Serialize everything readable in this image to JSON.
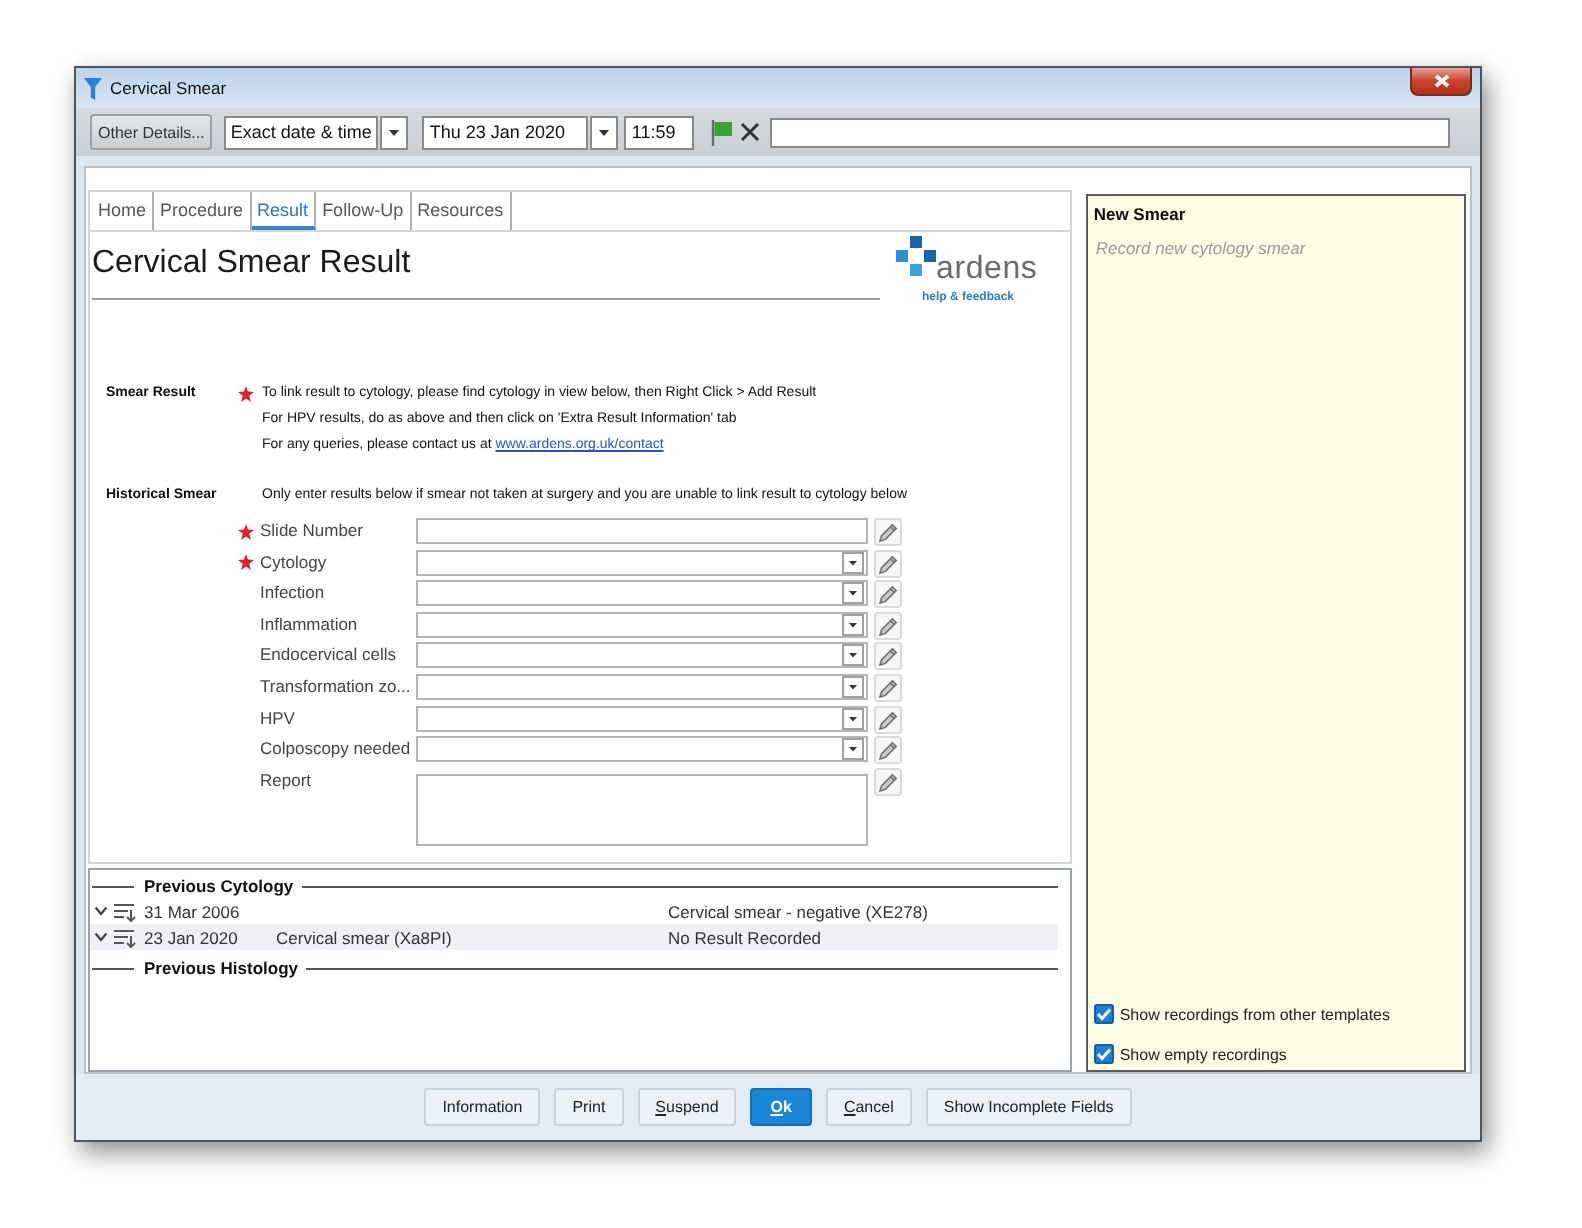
{
  "window": {
    "title": "Cervical Smear"
  },
  "toolbar": {
    "details_button": "Other Details...",
    "date_mode": {
      "value": "Exact date & time"
    },
    "date": {
      "value": "Thu 23 Jan 2020"
    },
    "time": {
      "value": "11:59"
    }
  },
  "tabs": [
    {
      "label": "Home",
      "selected": false
    },
    {
      "label": "Procedure",
      "selected": false
    },
    {
      "label": "Result",
      "selected": true
    },
    {
      "label": "Follow-Up",
      "selected": false
    },
    {
      "label": "Resources",
      "selected": false
    }
  ],
  "result_page": {
    "title": "Cervical Smear Result",
    "logo": {
      "wordmark": "ardens",
      "link": "help & feedback"
    },
    "sections": [
      {
        "label": "Smear Result",
        "required": true,
        "lines": [
          {
            "text": "To link result to cytology, please find cytology in view below, then Right Click > Add Result"
          },
          {
            "text": "For HPV results, do as above and then click on 'Extra Result Information' tab"
          },
          {
            "text": "For any queries, please contact us at",
            "link": "www.ardens.org.uk/contact"
          }
        ]
      },
      {
        "label": "Historical Smear",
        "required": false,
        "lines": [
          {
            "text": "Only enter results below if smear not taken at surgery and you are unable to link result to cytology below"
          }
        ]
      }
    ],
    "fields": [
      {
        "label": "Slide Number",
        "kind": "text",
        "required": true
      },
      {
        "label": "Cytology",
        "kind": "dropdown",
        "required": true
      },
      {
        "label": "Infection",
        "kind": "dropdown",
        "required": false
      },
      {
        "label": "Inflammation",
        "kind": "dropdown",
        "required": false
      },
      {
        "label": "Endocervical cells",
        "kind": "dropdown",
        "required": false
      },
      {
        "label": "Transformation zo...",
        "kind": "dropdown",
        "required": false
      },
      {
        "label": "HPV",
        "kind": "dropdown",
        "required": false
      },
      {
        "label": "Colposcopy needed",
        "kind": "dropdown",
        "required": false
      },
      {
        "label": "Report",
        "kind": "textarea",
        "required": false
      }
    ]
  },
  "previous_cytology": {
    "title": "Previous Cytology",
    "rows": [
      {
        "date": "31 Mar 2006",
        "result": "Cervical smear - negative (XE278)",
        "selected": false
      },
      {
        "date": "23 Jan 2020",
        "description": "Cervical smear (Xa8PI)",
        "result": "No Result Recorded",
        "selected": true
      }
    ]
  },
  "previous_histology": {
    "title": "Previous Histology"
  },
  "side_panel": {
    "title": "New Smear",
    "hint": "Record new cytology smear",
    "options": [
      {
        "label": "Show recordings from other templates",
        "checked": true
      },
      {
        "label": "Show empty recordings",
        "checked": true
      }
    ]
  },
  "buttons": [
    {
      "label": "Information",
      "mnemonic": false,
      "primary": false
    },
    {
      "label": "Print",
      "mnemonic": false,
      "primary": false
    },
    {
      "label": "Suspend",
      "mnemonic": true,
      "primary": false
    },
    {
      "label": "Ok",
      "mnemonic": true,
      "primary": true
    },
    {
      "label": "Cancel",
      "mnemonic": true,
      "primary": false
    },
    {
      "label": "Show Incomplete Fields",
      "mnemonic": false,
      "primary": false
    }
  ]
}
